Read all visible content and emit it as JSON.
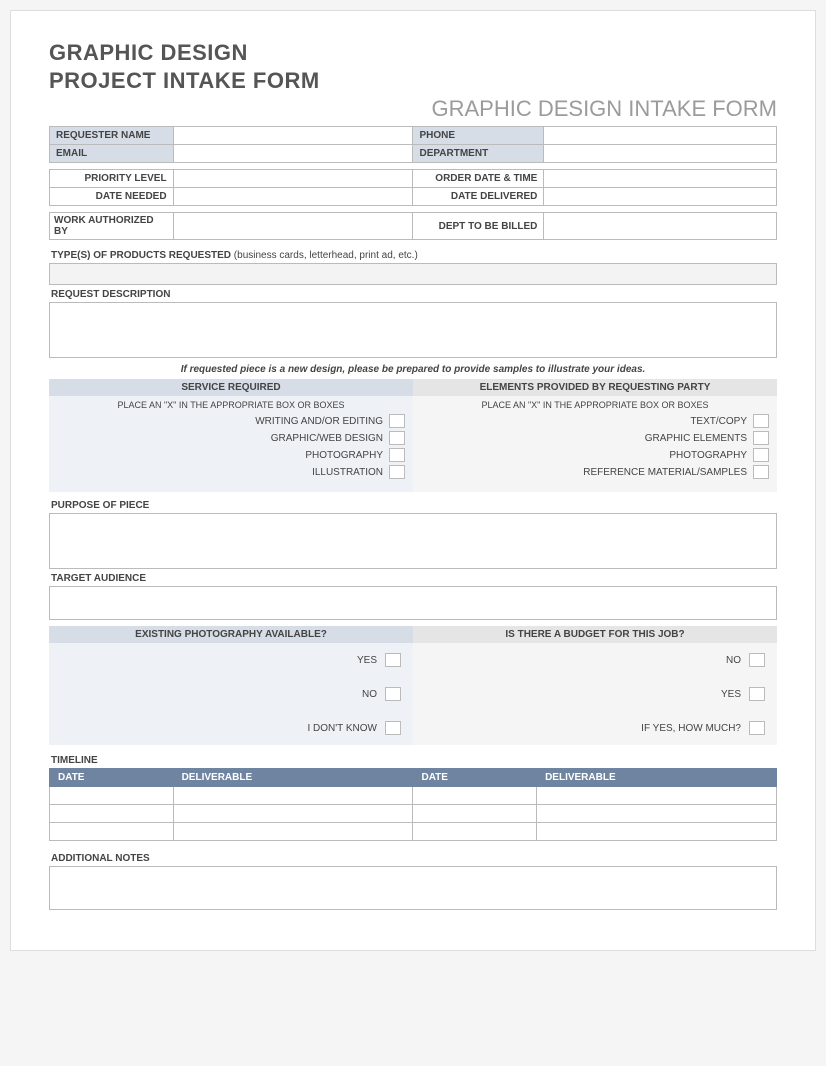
{
  "title_line1": "GRAPHIC DESIGN",
  "title_line2": "PROJECT INTAKE FORM",
  "subtitle": "GRAPHIC DESIGN INTAKE FORM",
  "contact": {
    "requester_label": "REQUESTER NAME",
    "requester_value": "",
    "phone_label": "PHONE",
    "phone_value": "",
    "email_label": "EMAIL",
    "email_value": "",
    "dept_label": "DEPARTMENT",
    "dept_value": ""
  },
  "dates": {
    "priority_label": "PRIORITY LEVEL",
    "priority_value": "",
    "order_label": "ORDER DATE & TIME",
    "order_value": "",
    "needed_label": "DATE NEEDED",
    "needed_value": "",
    "delivered_label": "DATE DELIVERED",
    "delivered_value": ""
  },
  "auth": {
    "work_label": "WORK AUTHORIZED BY",
    "work_value": "",
    "billed_label": "DEPT TO BE BILLED",
    "billed_value": ""
  },
  "products": {
    "label": "TYPE(S) OF PRODUCTS REQUESTED",
    "hint": "(business cards, letterhead, print ad, etc.)",
    "value": ""
  },
  "request_desc": {
    "label": "REQUEST DESCRIPTION",
    "value": ""
  },
  "note": "If requested piece is a new design, please be prepared to provide samples to illustrate your ideas.",
  "service": {
    "header": "SERVICE REQUIRED",
    "instr": "PLACE AN \"X\" IN THE APPROPRIATE BOX OR BOXES",
    "items": [
      "WRITING AND/OR EDITING",
      "GRAPHIC/WEB DESIGN",
      "PHOTOGRAPHY",
      "ILLUSTRATION"
    ]
  },
  "elements": {
    "header": "ELEMENTS PROVIDED BY REQUESTING PARTY",
    "instr": "PLACE AN \"X\" IN THE APPROPRIATE BOX OR BOXES",
    "items": [
      "TEXT/COPY",
      "GRAPHIC ELEMENTS",
      "PHOTOGRAPHY",
      "REFERENCE MATERIAL/SAMPLES"
    ]
  },
  "purpose": {
    "label": "PURPOSE OF PIECE",
    "value": ""
  },
  "audience": {
    "label": "TARGET AUDIENCE",
    "value": ""
  },
  "photo_q": {
    "header": "EXISTING PHOTOGRAPHY AVAILABLE?",
    "options": [
      "YES",
      "NO",
      "I DON'T KNOW"
    ]
  },
  "budget_q": {
    "header": "IS THERE A BUDGET FOR THIS JOB?",
    "options": [
      "NO",
      "YES",
      "IF YES, HOW MUCH?"
    ]
  },
  "timeline": {
    "label": "TIMELINE",
    "headers": [
      "DATE",
      "DELIVERABLE",
      "DATE",
      "DELIVERABLE"
    ],
    "rows": [
      [
        "",
        "",
        "",
        ""
      ],
      [
        "",
        "",
        "",
        ""
      ],
      [
        "",
        "",
        "",
        ""
      ]
    ]
  },
  "notes": {
    "label": "ADDITIONAL NOTES",
    "value": ""
  }
}
